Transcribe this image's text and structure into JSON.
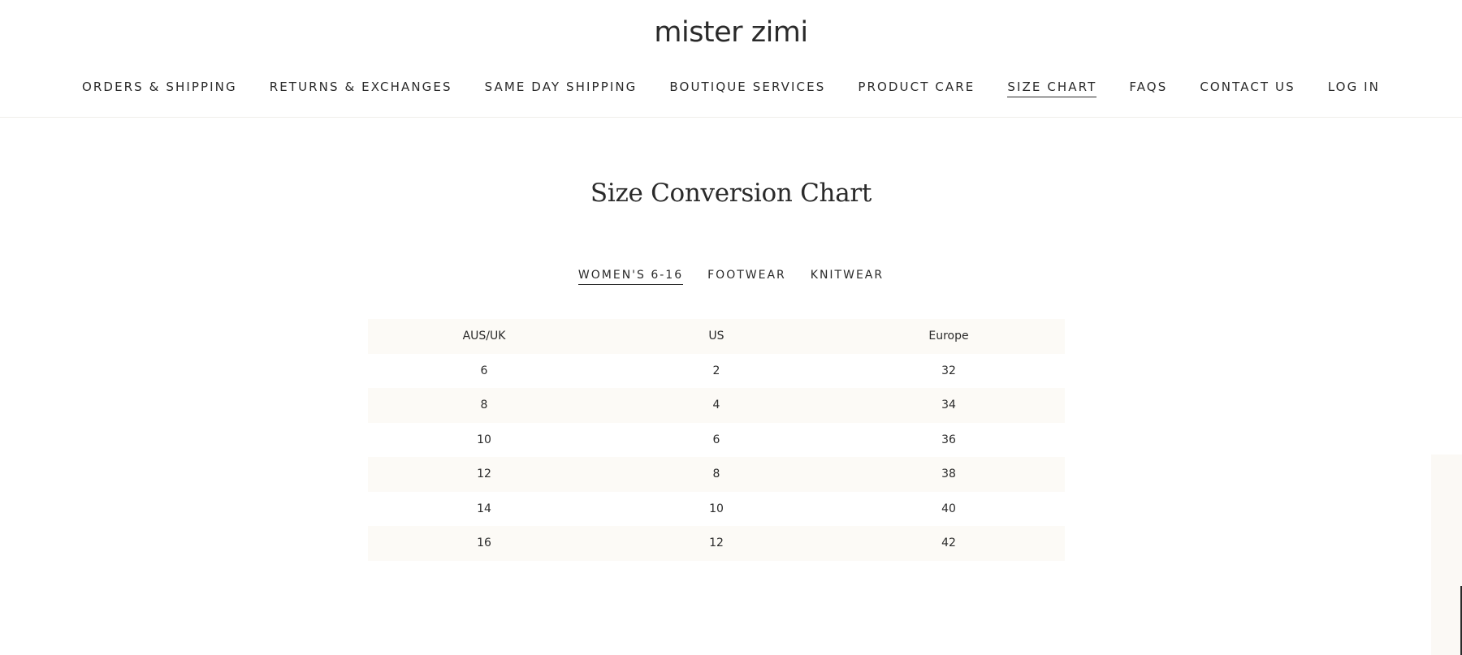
{
  "brand": "mister zimi",
  "nav": {
    "items": [
      {
        "label": "ORDERS & SHIPPING",
        "active": false
      },
      {
        "label": "RETURNS & EXCHANGES",
        "active": false
      },
      {
        "label": "SAME DAY SHIPPING",
        "active": false
      },
      {
        "label": "BOUTIQUE SERVICES",
        "active": false
      },
      {
        "label": "PRODUCT CARE",
        "active": false
      },
      {
        "label": "SIZE CHART",
        "active": true
      },
      {
        "label": "FAQS",
        "active": false
      },
      {
        "label": "CONTACT US",
        "active": false
      },
      {
        "label": "LOG IN",
        "active": false
      }
    ]
  },
  "page_title": "Size Conversion Chart",
  "tabs": [
    {
      "label": "WOMEN'S 6-16",
      "active": true
    },
    {
      "label": "FOOTWEAR",
      "active": false
    },
    {
      "label": "KNITWEAR",
      "active": false
    }
  ],
  "table": {
    "headers": [
      "AUS/UK",
      "US",
      "Europe"
    ],
    "rows": [
      [
        "6",
        "2",
        "32"
      ],
      [
        "8",
        "4",
        "34"
      ],
      [
        "10",
        "6",
        "36"
      ],
      [
        "12",
        "8",
        "38"
      ],
      [
        "14",
        "10",
        "40"
      ],
      [
        "16",
        "12",
        "42"
      ]
    ]
  },
  "colors": {
    "text": "#2a2a2a",
    "row_shade": "#fcfaf6",
    "background": "#ffffff"
  }
}
